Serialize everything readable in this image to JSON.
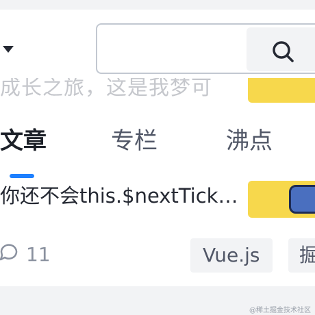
{
  "header": {
    "search": {
      "placeholder": "",
      "value": ""
    },
    "search_icon": "search-icon",
    "dropdown_icon": "caret-down-icon"
  },
  "faded_item": {
    "text": "成长之旅，这是我梦可"
  },
  "tabs": [
    {
      "label": "文章",
      "active": true
    },
    {
      "label": "专栏",
      "active": false
    },
    {
      "label": "沸点",
      "active": false
    }
  ],
  "article": {
    "title": "你还不会this.$nextTick…",
    "comment_count": "11",
    "tags": [
      "Vue.js",
      "掘"
    ]
  },
  "footer": {
    "watermark": "@稀土掘金技术社区"
  },
  "colors": {
    "accent": "#1e80ff",
    "thumb": "#f7d84c",
    "tag_bg": "#f2f3f5"
  }
}
